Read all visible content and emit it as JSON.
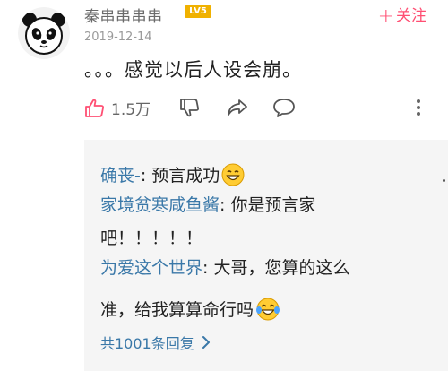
{
  "comment": {
    "username": "秦串串串串",
    "level_badge": "LV5",
    "follow_label": "关注",
    "date": "2019-12-14",
    "text": "。。。感觉以后人设会崩。",
    "like_count": "1.5万"
  },
  "replies": [
    {
      "user": "确丧-",
      "text": ": 预言成功",
      "emoji": "grinning-face-emoji"
    },
    {
      "user": "家境贫寒咸鱼酱",
      "text": ": 你是预言家",
      "continuation": "吧！！！！！"
    },
    {
      "user": "为爱这个世界",
      "text": ": 大哥，您算的这么",
      "continuation": "准，给我算算命行吗",
      "emoji": "tears-of-joy-emoji"
    }
  ],
  "total_replies_label": "共1001条回复",
  "colors": {
    "accent_pink": "#ff4f73",
    "link_blue": "#3a78a8",
    "badge_gold": "#f0b100",
    "reply_bg": "#f5f5f5"
  }
}
